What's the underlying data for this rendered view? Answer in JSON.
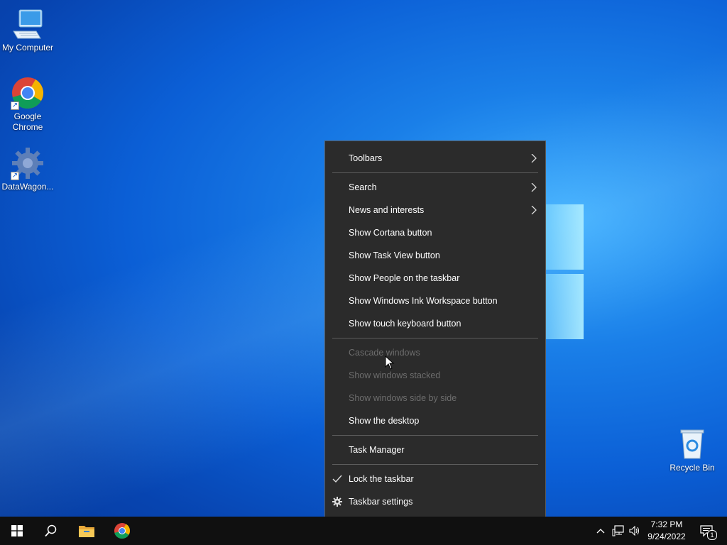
{
  "desktop": {
    "icons": [
      {
        "label": "My Computer"
      },
      {
        "label": "Google Chrome"
      },
      {
        "label": "DataWagon..."
      },
      {
        "label": "Recycle Bin"
      }
    ]
  },
  "context_menu": {
    "items": [
      {
        "label": "Toolbars",
        "submenu": true
      },
      {
        "label": "Search",
        "submenu": true
      },
      {
        "label": "News and interests",
        "submenu": true
      },
      {
        "label": "Show Cortana button"
      },
      {
        "label": "Show Task View button"
      },
      {
        "label": "Show People on the taskbar"
      },
      {
        "label": "Show Windows Ink Workspace button"
      },
      {
        "label": "Show touch keyboard button"
      },
      {
        "label": "Cascade windows",
        "disabled": true
      },
      {
        "label": "Show windows stacked",
        "disabled": true
      },
      {
        "label": "Show windows side by side",
        "disabled": true
      },
      {
        "label": "Show the desktop"
      },
      {
        "label": "Task Manager"
      },
      {
        "label": "Lock the taskbar",
        "checked": true
      },
      {
        "label": "Taskbar settings",
        "icon": "gear-icon"
      }
    ]
  },
  "taskbar": {
    "pinned": [
      "start-icon",
      "search-icon",
      "file-explorer-icon",
      "chrome-icon"
    ],
    "tray": {
      "icons": [
        "chevron-up-icon",
        "network-icon",
        "volume-icon"
      ],
      "time": "7:32 PM",
      "date": "9/24/2022",
      "notification_count": "1"
    }
  },
  "colors": {
    "menu_bg": "#2b2b2b",
    "menu_text": "#ffffff",
    "menu_disabled": "#6d6d6d",
    "taskbar_bg": "#101010",
    "desktop_blue": "#0b5fd6"
  }
}
